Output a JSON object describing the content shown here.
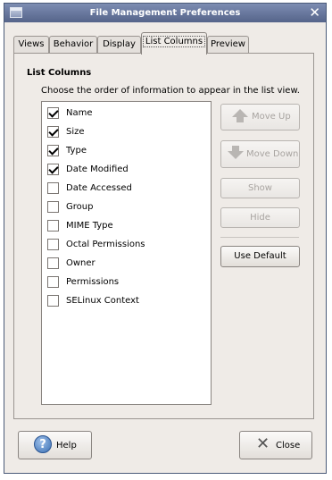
{
  "window": {
    "title": "File Management Preferences"
  },
  "tabs": [
    {
      "label": "Views"
    },
    {
      "label": "Behavior"
    },
    {
      "label": "Display"
    },
    {
      "label": "List Columns",
      "active": true
    },
    {
      "label": "Preview"
    }
  ],
  "section": {
    "title": "List Columns",
    "description": "Choose the order of information to appear in the list view."
  },
  "columns": [
    {
      "label": "Name",
      "checked": true
    },
    {
      "label": "Size",
      "checked": true
    },
    {
      "label": "Type",
      "checked": true
    },
    {
      "label": "Date Modified",
      "checked": true
    },
    {
      "label": "Date Accessed",
      "checked": false
    },
    {
      "label": "Group",
      "checked": false
    },
    {
      "label": "MIME Type",
      "checked": false
    },
    {
      "label": "Octal Permissions",
      "checked": false
    },
    {
      "label": "Owner",
      "checked": false
    },
    {
      "label": "Permissions",
      "checked": false
    },
    {
      "label": "SELinux Context",
      "checked": false
    }
  ],
  "buttons": {
    "move_up": "Move Up",
    "move_down": "Move Down",
    "show": "Show",
    "hide": "Hide",
    "use_default": "Use Default",
    "help": "Help",
    "close": "Close"
  }
}
